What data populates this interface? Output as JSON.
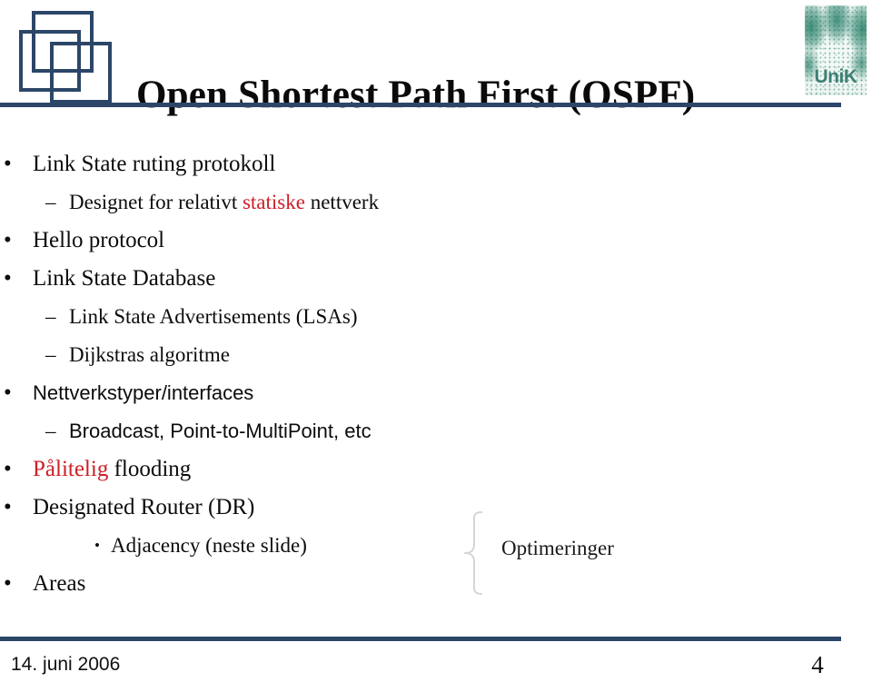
{
  "slide": {
    "title": "Open Shortest Path First (OSPF)",
    "accent_blue": "#2c4668",
    "highlight_red": "#cc2027",
    "logo_icon": "overlapping-squares-logo",
    "brand_logo_text": "UniK"
  },
  "content": [
    {
      "level": 1,
      "marker": "•",
      "font": "serif",
      "parts": [
        {
          "text": "Link State ruting protokoll",
          "color": "normal"
        }
      ]
    },
    {
      "level": 2,
      "marker": "–",
      "font": "serif",
      "parts": [
        {
          "text": "Designet for relativt ",
          "color": "normal"
        },
        {
          "text": "statiske",
          "color": "red"
        },
        {
          "text": " nettverk",
          "color": "normal"
        }
      ]
    },
    {
      "level": 1,
      "marker": "•",
      "font": "serif",
      "parts": [
        {
          "text": "Hello protocol",
          "color": "normal"
        }
      ]
    },
    {
      "level": 1,
      "marker": "•",
      "font": "serif",
      "parts": [
        {
          "text": "Link State Database",
          "color": "normal"
        }
      ]
    },
    {
      "level": 2,
      "marker": "–",
      "font": "serif",
      "parts": [
        {
          "text": "Link State Advertisements (LSAs)",
          "color": "normal"
        }
      ]
    },
    {
      "level": 2,
      "marker": "–",
      "font": "serif",
      "parts": [
        {
          "text": "Dijkstras algoritme",
          "color": "normal"
        }
      ]
    },
    {
      "level": 1,
      "marker": "•",
      "font": "sans",
      "parts": [
        {
          "text": "Nettverkstyper/interfaces",
          "color": "normal"
        }
      ]
    },
    {
      "level": 2,
      "marker": "–",
      "font": "sans",
      "parts": [
        {
          "text": "Broadcast, Point-to-MultiPoint, etc",
          "color": "normal"
        }
      ]
    },
    {
      "level": 1,
      "marker": "•",
      "font": "serif",
      "parts": [
        {
          "text": "Pålitelig",
          "color": "red"
        },
        {
          "text": " flooding",
          "color": "normal"
        }
      ]
    },
    {
      "level": 1,
      "marker": "•",
      "font": "serif",
      "parts": [
        {
          "text": "Designated Router (DR)",
          "color": "normal"
        }
      ]
    },
    {
      "level": 3,
      "marker": "•",
      "font": "serif",
      "parts": [
        {
          "text": "Adjacency (neste slide)",
          "color": "normal"
        }
      ]
    },
    {
      "level": 1,
      "marker": "•",
      "font": "serif",
      "parts": [
        {
          "text": "Areas",
          "color": "normal"
        }
      ]
    }
  ],
  "annotation": {
    "brace_icon": "curly-brace-right",
    "label": "Optimeringer"
  },
  "footer": {
    "date": "14. juni 2006",
    "page_number": "4"
  }
}
